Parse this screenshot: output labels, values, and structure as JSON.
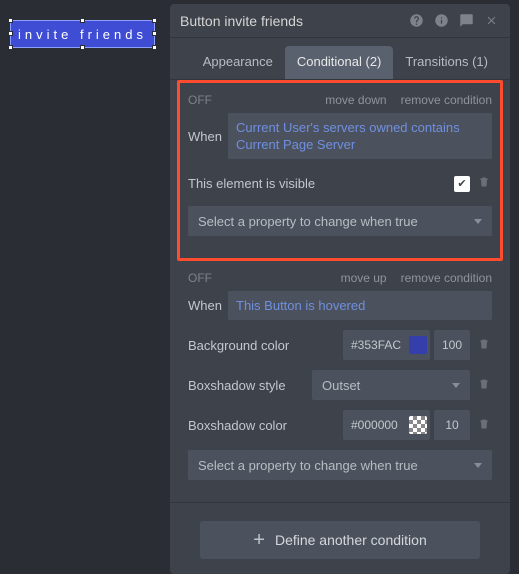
{
  "canvas": {
    "button_label": "invite friends"
  },
  "panel": {
    "title": "Button invite friends",
    "tabs": {
      "appearance": "Appearance",
      "conditional": "Conditional (2)",
      "transitions": "Transitions (1)"
    }
  },
  "conditions": [
    {
      "off": "OFF",
      "move": "move down",
      "remove": "remove condition",
      "when_label": "When",
      "expression": "Current User's servers owned contains Current Page Server",
      "visible_label": "This element is visible",
      "visible_checked": true,
      "select_placeholder": "Select a property to change when true"
    },
    {
      "off": "OFF",
      "move": "move up",
      "remove": "remove condition",
      "when_label": "When",
      "expression": "This Button is hovered",
      "props": {
        "bg_label": "Background color",
        "bg_hex": "#353FAC",
        "bg_color": "#353FAC",
        "bg_alpha": "100",
        "shadow_style_label": "Boxshadow style",
        "shadow_style_value": "Outset",
        "shadow_color_label": "Boxshadow color",
        "shadow_hex": "#000000",
        "shadow_alpha": "10"
      },
      "select_placeholder": "Select a property to change when true"
    }
  ],
  "define_label": "Define another condition"
}
